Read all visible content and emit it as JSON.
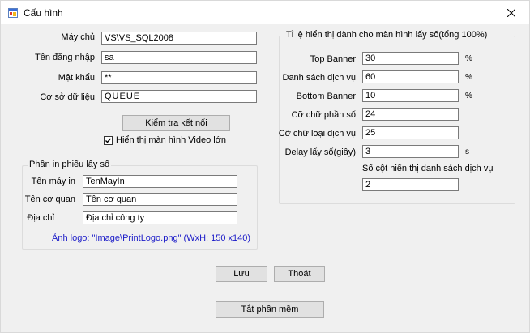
{
  "window": {
    "title": "Cấu hình"
  },
  "server": {
    "server_label": "Máy chủ",
    "server_value": "VS\\VS_SQL2008",
    "username_label": "Tên đăng nhập",
    "username_value": "sa",
    "password_label": "Mật khẩu",
    "password_value": "**",
    "database_label": "Cơ sở dữ liệu",
    "database_value": "QUEUE",
    "test_button": "Kiểm tra kết nối",
    "video_checkbox_label": "Hiển thị màn hình Video lớn",
    "video_checked": true
  },
  "print": {
    "group_title": "Phần in phiếu lấy số",
    "printer_label": "Tên máy in",
    "printer_value": "TenMayIn",
    "agency_label": "Tên cơ quan",
    "agency_value": "Tên cơ quan",
    "address_label": "Địa chỉ",
    "address_value": "Địa chỉ công ty",
    "logo_note": "Ảnh logo: \"Image\\PrintLogo.png\"  (WxH:  150 x140)"
  },
  "ratio": {
    "group_title": "Tỉ lệ hiển thị dành cho màn hình lấy số(tổng 100%)",
    "top_banner_label": "Top Banner",
    "top_banner_value": "30",
    "service_list_label": "Danh sách dịch vụ",
    "service_list_value": "60",
    "bottom_banner_label": "Bottom Banner",
    "bottom_banner_value": "10",
    "percent_unit": "%",
    "number_font_label": "Cỡ chữ phần số",
    "number_font_value": "24",
    "service_font_label": "Cỡ chữ loại dịch vụ",
    "service_font_value": "25",
    "delay_label": "Delay lấy số(giây)",
    "delay_value": "3",
    "seconds_unit": "s",
    "columns_label": "Số cột hiển thị danh sách dịch vụ",
    "columns_value": "2"
  },
  "actions": {
    "save": "Lưu",
    "exit": "Thoát",
    "shutdown": "Tắt phần mềm"
  }
}
